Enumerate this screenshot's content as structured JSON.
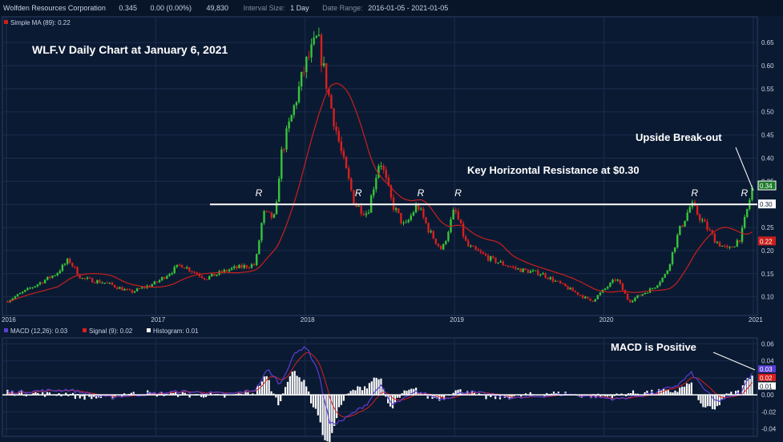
{
  "header": {
    "company": "Wolfden Resources Corporation",
    "last": "0.345",
    "change": "0.00 (0.00%)",
    "volume": "49,830",
    "interval_label": "Interval Size:",
    "interval": "1 Day",
    "range_label": "Date Range:",
    "range": "2016-01-05 - 2021-01-05"
  },
  "colors": {
    "bg": "#0b1a33",
    "up": "#39c43a",
    "down": "#d8201e",
    "ma": "#c8201c",
    "macd": "#5a3fd1",
    "signal": "#d8201e",
    "hist": "#ffffff",
    "resistance": "#ffffff"
  },
  "chart_data": [
    {
      "type": "candlestick",
      "title": "WLF.V Daily Chart at January 6, 2021",
      "legend": [
        "Simple MA (89): 0.22"
      ],
      "x_ticks": [
        "2016",
        "2017",
        "2018",
        "2019",
        "2020",
        "2021"
      ],
      "y_ticks": [
        "0.65",
        "0.60",
        "0.55",
        "0.50",
        "0.45",
        "0.40",
        "0.35",
        "0.30",
        "0.25",
        "0.20",
        "0.15",
        "0.10"
      ],
      "ylim": [
        0.07,
        0.69
      ],
      "price_labels": {
        "last": "0.34",
        "resistance": "0.30",
        "ma": "0.22"
      },
      "series_approx_close": [
        {
          "x": "2016-01",
          "y": 0.09
        },
        {
          "x": "2016-03",
          "y": 0.12
        },
        {
          "x": "2016-05",
          "y": 0.15
        },
        {
          "x": "2016-06",
          "y": 0.18
        },
        {
          "x": "2016-07",
          "y": 0.14
        },
        {
          "x": "2016-09",
          "y": 0.13
        },
        {
          "x": "2016-11",
          "y": 0.11
        },
        {
          "x": "2017-01",
          "y": 0.13
        },
        {
          "x": "2017-03",
          "y": 0.17
        },
        {
          "x": "2017-05",
          "y": 0.14
        },
        {
          "x": "2017-07",
          "y": 0.16
        },
        {
          "x": "2017-09",
          "y": 0.17
        },
        {
          "x": "2017-09-20",
          "y": 0.28
        },
        {
          "x": "2017-10-20",
          "y": 0.27
        },
        {
          "x": "2017-11",
          "y": 0.4
        },
        {
          "x": "2017-12",
          "y": 0.5
        },
        {
          "x": "2018-01",
          "y": 0.6
        },
        {
          "x": "2018-02",
          "y": 0.66
        },
        {
          "x": "2018-03",
          "y": 0.52
        },
        {
          "x": "2018-04",
          "y": 0.4
        },
        {
          "x": "2018-05",
          "y": 0.3
        },
        {
          "x": "2018-06",
          "y": 0.28
        },
        {
          "x": "2018-07",
          "y": 0.4
        },
        {
          "x": "2018-08",
          "y": 0.3
        },
        {
          "x": "2018-09",
          "y": 0.25
        },
        {
          "x": "2018-10",
          "y": 0.3
        },
        {
          "x": "2018-11",
          "y": 0.24
        },
        {
          "x": "2018-12",
          "y": 0.2
        },
        {
          "x": "2019-01",
          "y": 0.29
        },
        {
          "x": "2019-02",
          "y": 0.21
        },
        {
          "x": "2019-04",
          "y": 0.18
        },
        {
          "x": "2019-06",
          "y": 0.16
        },
        {
          "x": "2019-08",
          "y": 0.15
        },
        {
          "x": "2019-10",
          "y": 0.12
        },
        {
          "x": "2019-12",
          "y": 0.09
        },
        {
          "x": "2020-02",
          "y": 0.14
        },
        {
          "x": "2020-03",
          "y": 0.09
        },
        {
          "x": "2020-05",
          "y": 0.12
        },
        {
          "x": "2020-06",
          "y": 0.15
        },
        {
          "x": "2020-07",
          "y": 0.24
        },
        {
          "x": "2020-08",
          "y": 0.3
        },
        {
          "x": "2020-09",
          "y": 0.26
        },
        {
          "x": "2020-10",
          "y": 0.22
        },
        {
          "x": "2020-11",
          "y": 0.2
        },
        {
          "x": "2020-12",
          "y": 0.23
        },
        {
          "x": "2021-01",
          "y": 0.345
        }
      ],
      "annotations": [
        {
          "text": "Key Horizontal Resistance at $0.30"
        },
        {
          "text": "Upside Break-out"
        }
      ],
      "resistance_level": 0.3,
      "r_marks": [
        {
          "label": "R",
          "x": "2017-09"
        },
        {
          "label": "R",
          "x": "2018-05"
        },
        {
          "label": "R",
          "x": "2018-10"
        },
        {
          "label": "R",
          "x": "2019-01"
        },
        {
          "label": "R",
          "x": "2020-08"
        },
        {
          "label": "R",
          "x": "2020-12"
        }
      ]
    },
    {
      "type": "line",
      "legend": [
        "MACD (12,26): 0.03",
        "Signal (9): 0.02",
        "Histogram: 0.01"
      ],
      "y_ticks": [
        "0.06",
        "0.04",
        "0.02",
        "0.00",
        "-0.02",
        "-0.04"
      ],
      "ylim": [
        -0.045,
        0.065
      ],
      "price_labels": [
        "0.03",
        "0.02",
        "0.01"
      ],
      "annotation": "MACD is Positive",
      "macd_approx": [
        {
          "x": "2016-01",
          "y": 0.003
        },
        {
          "x": "2016-06",
          "y": 0.006
        },
        {
          "x": "2016-09",
          "y": -0.003
        },
        {
          "x": "2017-03",
          "y": 0.004
        },
        {
          "x": "2017-07",
          "y": 0.001
        },
        {
          "x": "2017-09",
          "y": 0.006
        },
        {
          "x": "2017-10",
          "y": 0.03
        },
        {
          "x": "2017-11",
          "y": 0.012
        },
        {
          "x": "2017-12",
          "y": 0.045
        },
        {
          "x": "2018-01",
          "y": 0.058
        },
        {
          "x": "2018-02",
          "y": 0.03
        },
        {
          "x": "2018-03",
          "y": -0.035
        },
        {
          "x": "2018-04",
          "y": -0.03
        },
        {
          "x": "2018-06",
          "y": -0.01
        },
        {
          "x": "2018-07",
          "y": 0.012
        },
        {
          "x": "2018-08",
          "y": -0.012
        },
        {
          "x": "2018-10",
          "y": 0.004
        },
        {
          "x": "2018-12",
          "y": -0.005
        },
        {
          "x": "2019-02",
          "y": 0.004
        },
        {
          "x": "2019-06",
          "y": -0.004
        },
        {
          "x": "2019-10",
          "y": 0.001
        },
        {
          "x": "2020-02",
          "y": -0.005
        },
        {
          "x": "2020-05",
          "y": 0.002
        },
        {
          "x": "2020-07",
          "y": 0.012
        },
        {
          "x": "2020-08",
          "y": 0.026
        },
        {
          "x": "2020-09",
          "y": 0.008
        },
        {
          "x": "2020-10",
          "y": -0.008
        },
        {
          "x": "2020-12",
          "y": 0.002
        },
        {
          "x": "2021-01",
          "y": 0.03
        }
      ]
    }
  ]
}
